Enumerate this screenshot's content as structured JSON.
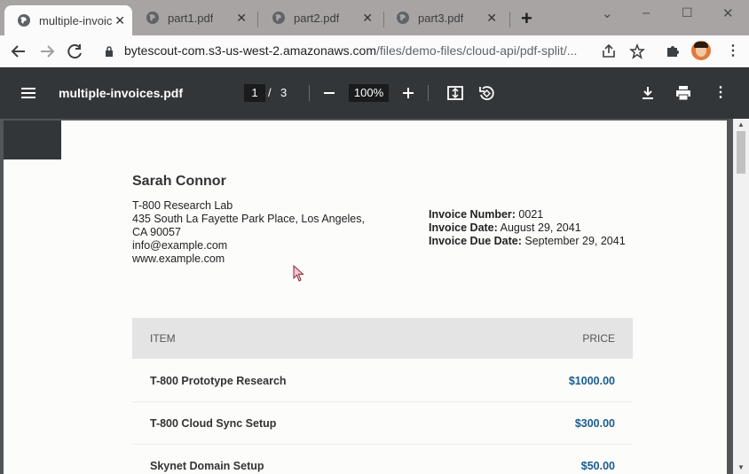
{
  "browser": {
    "tabs": [
      {
        "title": "multiple-invoic",
        "active": true
      },
      {
        "title": "part1.pdf",
        "active": false
      },
      {
        "title": "part2.pdf",
        "active": false
      },
      {
        "title": "part3.pdf",
        "active": false
      }
    ],
    "url_host": "bytescout-com.s3-us-west-2.amazonaws.com",
    "url_path": "/files/demo-files/cloud-api/pdf-split/..."
  },
  "pdf_viewer": {
    "file_title": "multiple-invoices.pdf",
    "current_page": "1",
    "page_separator": "/",
    "total_pages": "3",
    "zoom": "100%"
  },
  "invoice": {
    "seller_name": "Sarah Connor",
    "seller_lines": [
      "T-800 Research Lab",
      "435 South La Fayette Park Place, Los Angeles,",
      "CA 90057",
      "info@example.com",
      "www.example.com"
    ],
    "meta": [
      {
        "label": "Invoice Number:",
        "value": "0021"
      },
      {
        "label": "Invoice Date:",
        "value": "August 29, 2041"
      },
      {
        "label": "Invoice Due Date:",
        "value": "September 29, 2041"
      }
    ],
    "table_headers": {
      "item": "ITEM",
      "price": "PRICE"
    },
    "items": [
      {
        "name": "T-800 Prototype Research",
        "price": "$1000.00"
      },
      {
        "name": "T-800 Cloud Sync Setup",
        "price": "$300.00"
      },
      {
        "name": "Skynet Domain Setup",
        "price": "$50.00"
      }
    ]
  },
  "colors": {
    "price_text": "#1a5c8c",
    "pdf_toolbar": "#323639",
    "tabstrip": "#a9a4a4"
  }
}
